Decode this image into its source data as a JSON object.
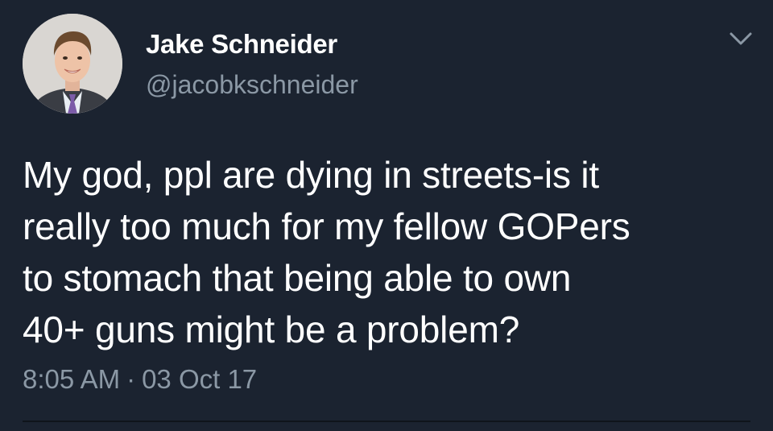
{
  "author": {
    "display_name": "Jake Schneider",
    "handle": "@jacobkschneider",
    "avatar_icon": "profile-photo"
  },
  "tweet": {
    "text_lines": [
      "My god, ppl are dying in streets-is it",
      "really too much for my fellow GOPers",
      "to stomach that being able to own",
      "40+ guns might be a problem?"
    ],
    "time": "8:05 AM",
    "separator": "·",
    "date": "03 Oct 17"
  },
  "icons": {
    "menu": "chevron-down-icon"
  },
  "colors": {
    "background": "#1b2330",
    "primary_text": "#ffffff",
    "secondary_text": "#8b98a5"
  }
}
